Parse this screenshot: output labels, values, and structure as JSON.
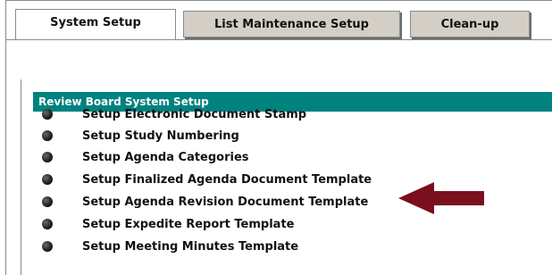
{
  "tabs": {
    "system_setup": "System Setup",
    "list_maintenance": "List Maintenance Setup",
    "cleanup": "Clean-up"
  },
  "section": {
    "title": "Review Board System Setup"
  },
  "items": [
    "Setup Electronic Document Stamp",
    "Setup Study Numbering",
    "Setup Agenda Categories",
    "Setup Finalized Agenda Document Template",
    "Setup Agenda Revision Document Template",
    "Setup Expedite Report Template",
    "Setup Meeting Minutes Template"
  ],
  "colors": {
    "section_header": "#00827f",
    "arrow": "#7a0f1e",
    "inactive_tab": "#d4cfc6"
  },
  "icons": {
    "bullet": "bullet-icon",
    "arrow": "arrow-left-icon"
  }
}
